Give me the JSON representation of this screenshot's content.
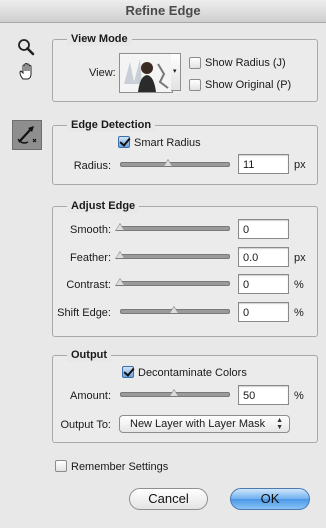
{
  "window": {
    "title": "Refine Edge"
  },
  "tools": {
    "zoom_icon": "zoom-tool",
    "hand_icon": "hand-tool",
    "refine_icon": "refine-radius-tool"
  },
  "view_mode": {
    "title": "View Mode",
    "view_label": "View:",
    "show_radius_label": "Show Radius (J)",
    "show_radius_checked": false,
    "show_original_label": "Show Original (P)",
    "show_original_checked": false
  },
  "edge_detection": {
    "title": "Edge Detection",
    "smart_radius_label": "Smart Radius",
    "smart_radius_checked": true,
    "radius_label": "Radius:",
    "radius_value": "11",
    "radius_unit": "px",
    "radius_slider_fraction": 0.44
  },
  "adjust_edge": {
    "title": "Adjust Edge",
    "smooth_label": "Smooth:",
    "smooth_value": "0",
    "smooth_slider_fraction": 0.0,
    "feather_label": "Feather:",
    "feather_value": "0.0",
    "feather_unit": "px",
    "feather_slider_fraction": 0.0,
    "contrast_label": "Contrast:",
    "contrast_value": "0",
    "contrast_unit": "%",
    "contrast_slider_fraction": 0.0,
    "shift_label": "Shift Edge:",
    "shift_value": "0",
    "shift_unit": "%",
    "shift_slider_fraction": 0.5
  },
  "output": {
    "title": "Output",
    "decontaminate_label": "Decontaminate Colors",
    "decontaminate_checked": true,
    "amount_label": "Amount:",
    "amount_value": "50",
    "amount_unit": "%",
    "amount_slider_fraction": 0.5,
    "output_to_label": "Output To:",
    "output_to_value": "New Layer with Layer Mask"
  },
  "remember": {
    "label": "Remember Settings",
    "checked": false
  },
  "buttons": {
    "cancel": "Cancel",
    "ok": "OK"
  }
}
